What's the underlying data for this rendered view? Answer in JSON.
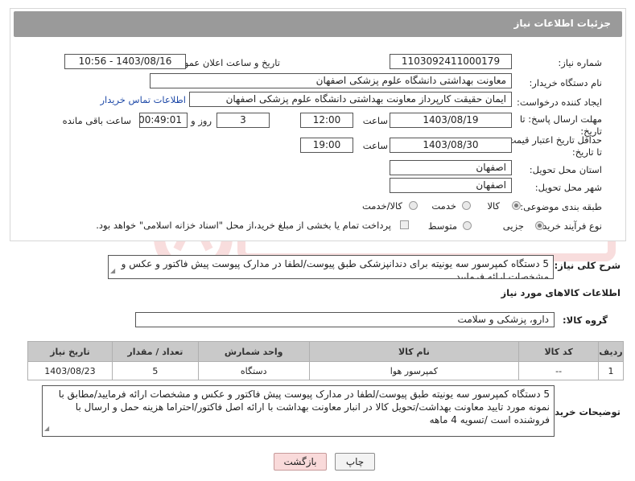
{
  "header": {
    "title": "جزئیات اطلاعات نیاز"
  },
  "fields": {
    "need_number_label": "شماره نیاز:",
    "need_number": "1103092411000179",
    "announce_label": "تاریخ و ساعت اعلان عمومی:",
    "announce_value": "1403/08/16 - 10:56",
    "buyer_label": "نام دستگاه خریدار:",
    "buyer_value": "معاونت بهداشتی دانشگاه علوم پزشکی اصفهان",
    "creator_label": "ایجاد کننده درخواست:",
    "creator_value": "ایمان حقیقت کارپرداز معاونت بهداشتی دانشگاه علوم پزشکی اصفهان",
    "contact_link": "اطلاعات تماس خریدار",
    "deadline_label": "مهلت ارسال پاسخ: تا تاریخ:",
    "deadline_date": "1403/08/19",
    "time_word": "ساعت",
    "deadline_time": "12:00",
    "days_value": "3",
    "days_word": "روز و",
    "remaining_time": "00:49:01",
    "remaining_word": "ساعت باقی مانده",
    "validity_label": "حداقل تاریخ اعتبار قیمت: تا تاریخ:",
    "validity_date": "1403/08/30",
    "validity_time": "19:00",
    "province_label": "استان محل تحویل:",
    "province_value": "اصفهان",
    "city_label": "شهر محل تحویل:",
    "city_value": "اصفهان",
    "category_label": "طبقه بندی موضوعی:",
    "category_options": [
      "کالا",
      "خدمت",
      "کالا/خدمت"
    ],
    "process_label": "نوع فرآیند خرید :",
    "process_options": [
      "جزیی",
      "متوسط"
    ],
    "payment_note": "پرداخت تمام یا بخشی از مبلغ خرید،از محل \"اسناد خزانه اسلامی\" خواهد بود."
  },
  "description": {
    "label": "شرح کلی نیاز:",
    "text": "5 دستگاه کمپرسور سه یونیته برای دندانپزشکی طبق پیوست/لطفا در مدارک پیوست پیش فاکتور و عکس و مشخصات ارائه فرمایید"
  },
  "goods_section": {
    "title": "اطلاعات کالاهای مورد نیاز",
    "group_label": "گروه کالا:",
    "group_value": "دارو، پزشکی و سلامت"
  },
  "table": {
    "headers": [
      "ردیف",
      "کد کالا",
      "نام کالا",
      "واحد شمارش",
      "تعداد / مقدار",
      "تاریخ نیاز"
    ],
    "rows": [
      [
        "1",
        "--",
        "کمپرسور هوا",
        "دستگاه",
        "5",
        "1403/08/23"
      ]
    ]
  },
  "buyer_notes": {
    "label": "توضیحات خریدار:",
    "text": "5 دستگاه کمپرسور سه یونیته طبق پیوست/لطفا در مدارک پیوست پیش فاکتور و عکس و مشخصات ارائه فرمایید/مطابق با نمونه مورد تایید معاونت بهداشت/تحویل کالا در انبار معاونت بهداشت با ارائه اصل فاکتور/احتراما هزینه حمل و ارسال با فروشنده است /تسویه 4 ماهه"
  },
  "buttons": {
    "print": "چاپ",
    "back": "بازگشت"
  },
  "colors": {
    "header_bg": "#9a9a9a",
    "link": "#1f4aa8",
    "back_button": "#f9dada"
  }
}
